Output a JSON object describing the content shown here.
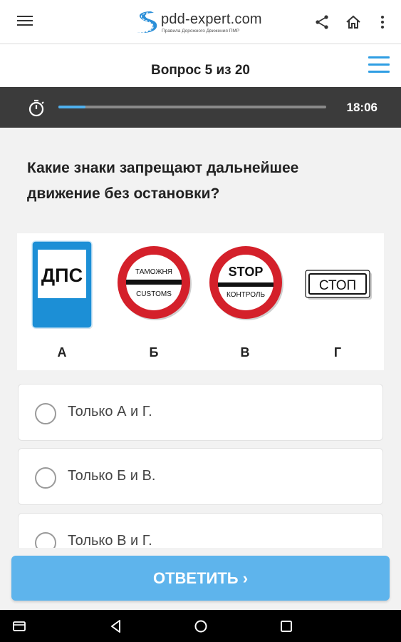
{
  "app": {
    "brand_name": "pdd-expert.com",
    "brand_tagline": "Правила Дорожного Движения ПМР"
  },
  "question_header": {
    "title": "Вопрос 5 из 20"
  },
  "timer": {
    "time": "18:06",
    "progress_fraction": 0.1,
    "accent_color": "#4fb0ee"
  },
  "question": {
    "text": "Какие знаки запрещают дальнейшее движение без остановки?"
  },
  "signs": [
    {
      "label": "А",
      "text": "ДПС"
    },
    {
      "label": "Б",
      "top_text": "ТАМОЖНЯ",
      "bottom_text": "CUSTOMS"
    },
    {
      "label": "В",
      "top_text": "STOP",
      "bottom_text": "КОНТРОЛЬ"
    },
    {
      "label": "Г",
      "text": "СТОП"
    }
  ],
  "options": [
    {
      "text": "Только А и Г."
    },
    {
      "text": "Только Б и В."
    },
    {
      "text": "Только В и Г."
    }
  ],
  "footer": {
    "answer_label": "ОТВЕТИТЬ ›",
    "button_color": "#5eb4ec"
  },
  "icons": {
    "menu": "hamburger-icon",
    "share": "share-icon",
    "home": "home-icon",
    "more": "more-vert-icon",
    "question_list": "list-icon",
    "stopwatch": "stopwatch-icon"
  }
}
